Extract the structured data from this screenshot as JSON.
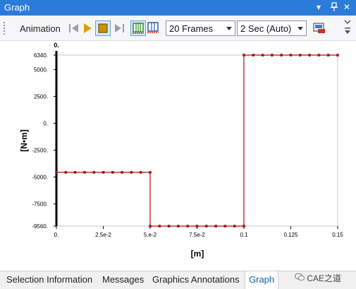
{
  "window": {
    "title": "Graph",
    "dropdown_glyph": "▾",
    "pin_glyph": "📌",
    "close_glyph": "✕"
  },
  "toolbar": {
    "animation_label": "Animation",
    "frames_select": "20 Frames",
    "duration_select": "2 Sec (Auto)",
    "colors": {
      "play": "#e0a000",
      "stop": "#c89400",
      "accent": "#2b7bd9"
    }
  },
  "tabs": [
    {
      "label": "Selection Information",
      "active": false
    },
    {
      "label": "Messages",
      "active": false
    },
    {
      "label": "Graphics Annotations",
      "active": false
    },
    {
      "label": "Graph",
      "active": true
    }
  ],
  "watermark": "CAE之道",
  "chart_data": {
    "type": "line",
    "xlabel": "[m]",
    "ylabel": "[N•m]",
    "top_label": "0.",
    "xlim": [
      0,
      0.15
    ],
    "ylim": [
      -9560,
      6340
    ],
    "x_ticks": [
      {
        "v": 0,
        "label": "0."
      },
      {
        "v": 0.025,
        "label": "2.5e-2"
      },
      {
        "v": 0.05,
        "label": "5.e-2"
      },
      {
        "v": 0.075,
        "label": "7.5e-2"
      },
      {
        "v": 0.1,
        "label": "0.1"
      },
      {
        "v": 0.125,
        "label": "0.125"
      },
      {
        "v": 0.15,
        "label": "0.15"
      }
    ],
    "y_ticks": [
      {
        "v": 6340,
        "label": "6340."
      },
      {
        "v": 5000,
        "label": "5000."
      },
      {
        "v": 2500,
        "label": "2500."
      },
      {
        "v": 0,
        "label": "0."
      },
      {
        "v": -2500,
        "label": "-2500."
      },
      {
        "v": -5000,
        "label": "-5000."
      },
      {
        "v": -7500,
        "label": "-7500."
      },
      {
        "v": -9560,
        "label": "-9560."
      }
    ],
    "series": [
      {
        "color": "#aa1111",
        "x": [
          0,
          0.005,
          0.01,
          0.015,
          0.02,
          0.025,
          0.03,
          0.035,
          0.04,
          0.045,
          0.05,
          0.05,
          0.055,
          0.06,
          0.065,
          0.07,
          0.075,
          0.08,
          0.085,
          0.09,
          0.095,
          0.1,
          0.1,
          0.105,
          0.11,
          0.115,
          0.12,
          0.125,
          0.13,
          0.135,
          0.14,
          0.145,
          0.15
        ],
        "y": [
          -4560,
          -4560,
          -4560,
          -4560,
          -4560,
          -4560,
          -4560,
          -4560,
          -4560,
          -4560,
          -4560,
          -9560,
          -9560,
          -9560,
          -9560,
          -9560,
          -9560,
          -9560,
          -9560,
          -9560,
          -9560,
          -9560,
          6340,
          6340,
          6340,
          6340,
          6340,
          6340,
          6340,
          6340,
          6340,
          6340,
          6340
        ]
      }
    ]
  }
}
